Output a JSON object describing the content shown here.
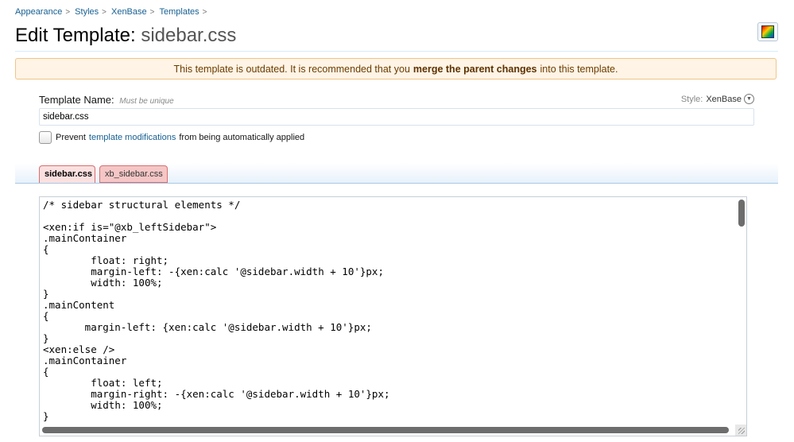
{
  "breadcrumb": [
    {
      "label": "Appearance"
    },
    {
      "label": "Styles"
    },
    {
      "label": "XenBase"
    },
    {
      "label": "Templates"
    }
  ],
  "breadcrumb_separator": ">",
  "page": {
    "title_prefix": "Edit Template:",
    "title_name": "sidebar.css"
  },
  "notice": {
    "before": "This template is outdated. It is recommended that you",
    "link": "merge the parent changes",
    "after": "into this template."
  },
  "form": {
    "name_label": "Template Name:",
    "name_hint": "Must be unique",
    "name_value": "sidebar.css",
    "style_label": "Style:",
    "style_value": "XenBase",
    "checkbox_before": "Prevent",
    "checkbox_link": "template modifications",
    "checkbox_after": "from being automatically applied"
  },
  "tabs": [
    {
      "label": "sidebar.css",
      "active": true
    },
    {
      "label": "xb_sidebar.css",
      "active": false
    }
  ],
  "editor": {
    "code": "/* sidebar structural elements */\n\n<xen:if is=\"@xb_leftSidebar\">\n.mainContainer\n{\n\tfloat: right;\n\tmargin-left: -{xen:calc '@sidebar.width + 10'}px;\n\twidth: 100%;\n}\n.mainContent\n{\n       margin-left: {xen:calc '@sidebar.width + 10'}px;\n}\n<xen:else />\n.mainContainer\n{\n\tfloat: left;\n\tmargin-right: -{xen:calc '@sidebar.width + 10'}px;\n\twidth: 100%;\n}"
  },
  "colors": {
    "link": "#176093",
    "notice_bg": "#fff4e5",
    "tab_active_bg": "#fbe0e0"
  }
}
